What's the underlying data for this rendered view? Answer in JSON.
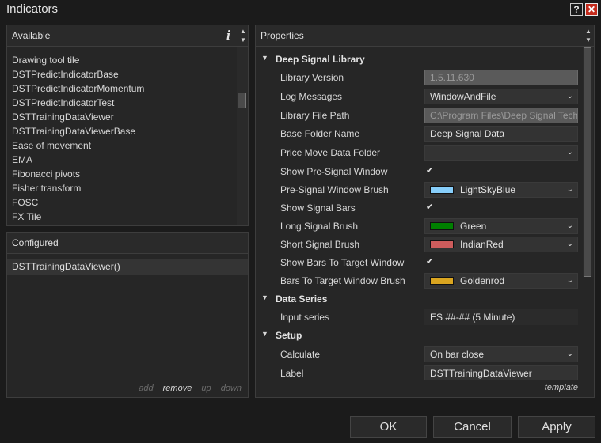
{
  "window": {
    "title": "Indicators",
    "help_glyph": "?",
    "close_glyph": "✕"
  },
  "available": {
    "header": "Available",
    "info_glyph": "i",
    "items": [
      "Drawing tool tile",
      "DSTPredictIndicatorBase",
      "DSTPredictIndicatorMomentum",
      "DSTPredictIndicatorTest",
      "DSTTrainingDataViewer",
      "DSTTrainingDataViewerBase",
      "Ease of movement",
      "EMA",
      "Fibonacci pivots",
      "Fisher transform",
      "FOSC",
      "FX Tile"
    ]
  },
  "configured": {
    "header": "Configured",
    "items": [
      "DSTTrainingDataViewer()"
    ],
    "actions": {
      "add": "add",
      "remove": "remove",
      "up": "up",
      "down": "down"
    }
  },
  "properties": {
    "header": "Properties",
    "template_label": "template",
    "categories": {
      "deep_signal_library": "Deep Signal Library",
      "data_series": "Data Series",
      "setup": "Setup"
    },
    "rows": {
      "library_version": {
        "label": "Library Version",
        "value": "1.5.11.630"
      },
      "log_messages": {
        "label": "Log Messages",
        "value": "WindowAndFile"
      },
      "library_file_path": {
        "label": "Library File Path",
        "value": "C:\\Program Files\\Deep Signal Tech"
      },
      "base_folder_name": {
        "label": "Base Folder Name",
        "value": "Deep Signal Data"
      },
      "price_move_data_folder": {
        "label": "Price Move Data Folder",
        "value": ""
      },
      "show_pre_signal_window": {
        "label": "Show Pre-Signal Window",
        "checked": true
      },
      "pre_signal_window_brush": {
        "label": "Pre-Signal Window Brush",
        "value": "LightSkyBlue",
        "color": "#87cefa"
      },
      "show_signal_bars": {
        "label": "Show Signal Bars",
        "checked": true
      },
      "long_signal_brush": {
        "label": "Long Signal Brush",
        "value": "Green",
        "color": "#008000"
      },
      "short_signal_brush": {
        "label": "Short Signal Brush",
        "value": "IndianRed",
        "color": "#cd5c5c"
      },
      "show_bars_to_target_window": {
        "label": "Show Bars To Target Window",
        "checked": true
      },
      "bars_to_target_window_brush": {
        "label": "Bars To Target Window Brush",
        "value": "Goldenrod",
        "color": "#daa520"
      },
      "input_series": {
        "label": "Input series",
        "value": "ES ##-## (5 Minute)"
      },
      "calculate": {
        "label": "Calculate",
        "value": "On bar close"
      },
      "label": {
        "label": "Label",
        "value": "DSTTrainingDataViewer"
      }
    }
  },
  "buttons": {
    "ok": "OK",
    "cancel": "Cancel",
    "apply": "Apply"
  },
  "colors": {
    "background": "#1b1b1b",
    "panel": "#262626",
    "close_button": "#c42b1c"
  }
}
